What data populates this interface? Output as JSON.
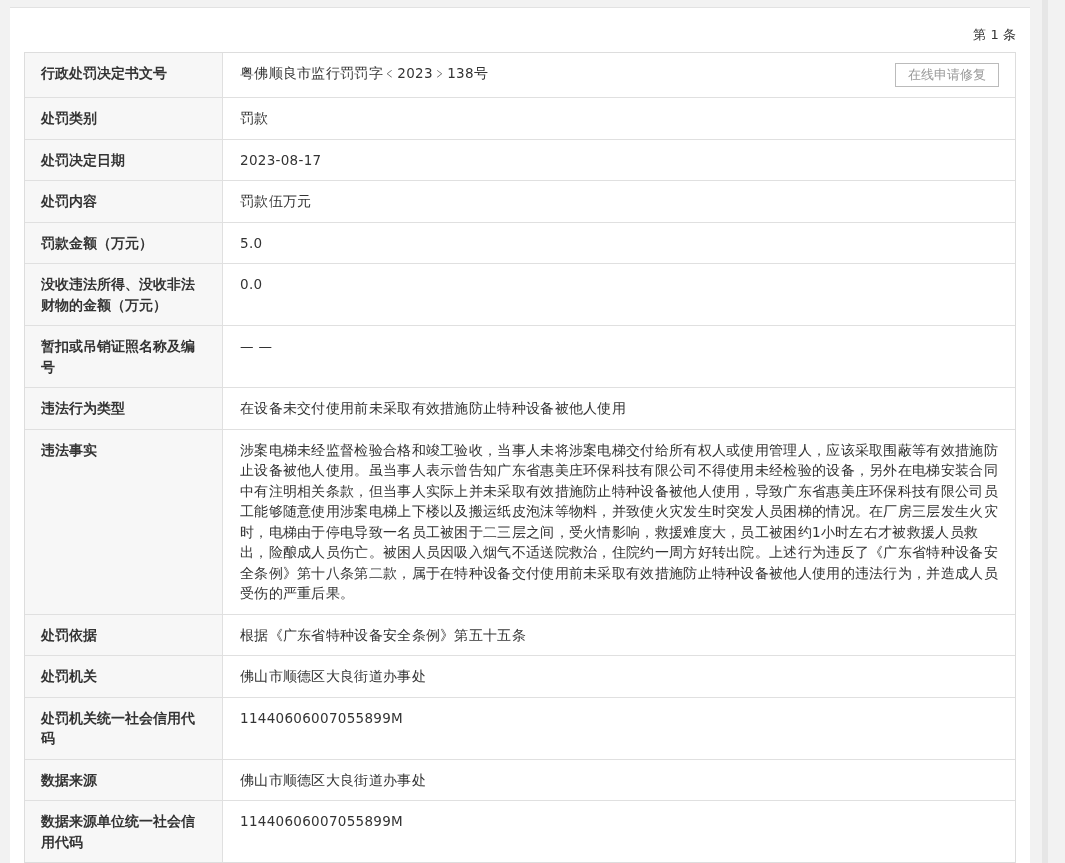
{
  "record_count": "第 1 条",
  "repair_button": "在线申请修复",
  "rows": [
    {
      "label": "行政处罚决定书文号",
      "value": "粤佛顺良市监行罚罚字﹤2023﹥138号",
      "kind": "with_button"
    },
    {
      "label": "处罚类别",
      "value": "罚款",
      "kind": "plain"
    },
    {
      "label": "处罚决定日期",
      "value": "2023-08-17",
      "kind": "plain"
    },
    {
      "label": "处罚内容",
      "value": "罚款伍万元",
      "kind": "plain"
    },
    {
      "label": "罚款金额（万元）",
      "value": "5.0",
      "kind": "plain"
    },
    {
      "label": "没收违法所得、没收非法财物的金额（万元）",
      "value": "0.0",
      "kind": "plain"
    },
    {
      "label": "暂扣或吊销证照名称及编号",
      "value": "— —",
      "kind": "plain"
    },
    {
      "label": "违法行为类型",
      "value": "在设备未交付使用前未采取有效措施防止特种设备被他人使用",
      "kind": "plain"
    },
    {
      "label": "违法事实",
      "value": "涉案电梯未经监督检验合格和竣工验收，当事人未将涉案电梯交付给所有权人或使用管理人，应该采取围蔽等有效措施防止设备被他人使用。虽当事人表示曾告知广东省惠美庄环保科技有限公司不得使用未经检验的设备，另外在电梯安装合同中有注明相关条款，但当事人实际上并未采取有效措施防止特种设备被他人使用，导致广东省惠美庄环保科技有限公司员工能够随意使用涉案电梯上下楼以及搬运纸皮泡沫等物料，并致使火灾发生时突发人员困梯的情况。在厂房三层发生火灾时，电梯由于停电导致一名员工被困于二三层之间，受火情影响，救援难度大，员工被困约1小时左右才被救援人员救出，险酿成人员伤亡。被困人员因吸入烟气不适送院救治，住院约一周方好转出院。上述行为违反了《广东省特种设备安全条例》第十八条第二款，属于在特种设备交付使用前未采取有效措施防止特种设备被他人使用的违法行为，并造成人员受伤的严重后果。",
      "kind": "plain"
    },
    {
      "label": "处罚依据",
      "value": "根据《广东省特种设备安全条例》第五十五条",
      "kind": "plain"
    },
    {
      "label": "处罚机关",
      "value": "佛山市顺德区大良街道办事处",
      "kind": "plain"
    },
    {
      "label": "处罚机关统一社会信用代码",
      "value": "11440606007055899M",
      "kind": "plain"
    },
    {
      "label": "数据来源",
      "value": "佛山市顺德区大良街道办事处",
      "kind": "plain"
    },
    {
      "label": "数据来源单位统一社会信用代码",
      "value": "11440606007055899M",
      "kind": "plain"
    }
  ]
}
